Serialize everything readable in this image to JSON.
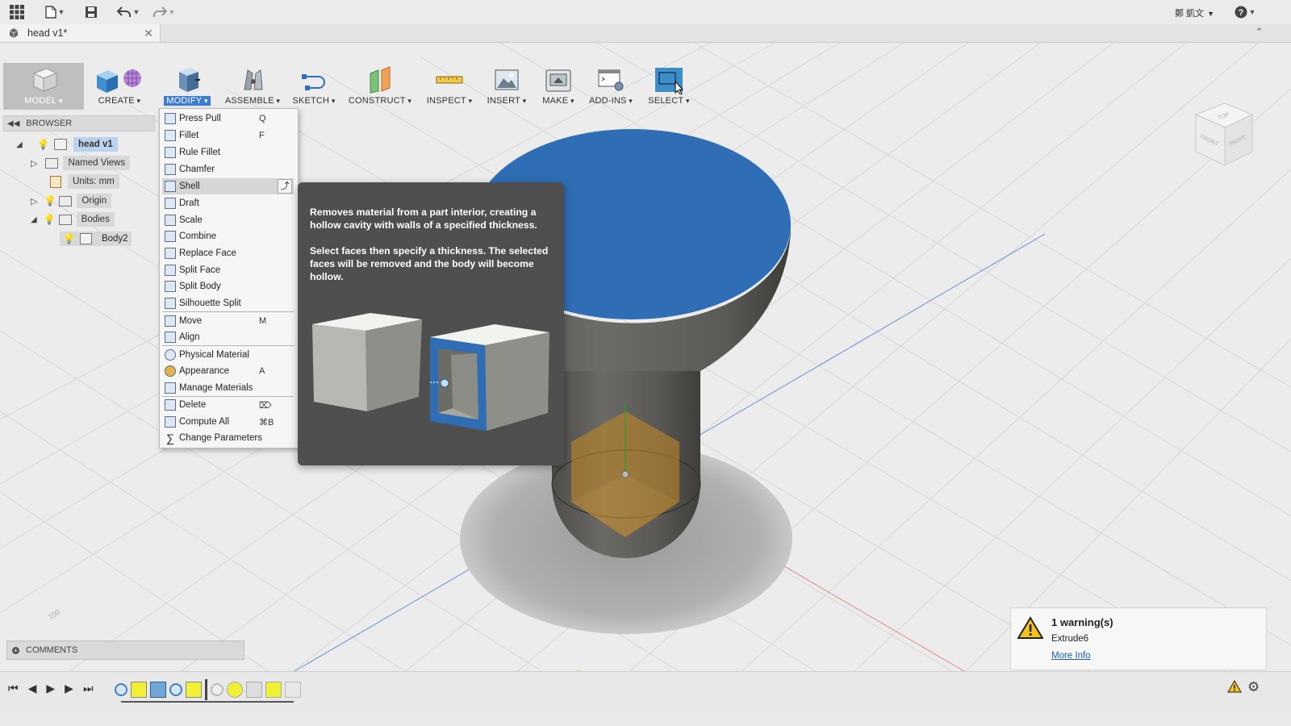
{
  "app": {
    "user_name": "鄭 凱文"
  },
  "document": {
    "tab_title": "head v1*"
  },
  "toolbar": {
    "workspace_label": "MODEL",
    "tools": [
      "CREATE",
      "MODIFY",
      "ASSEMBLE",
      "SKETCH",
      "CONSTRUCT",
      "INSPECT",
      "INSERT",
      "MAKE",
      "ADD-INS",
      "SELECT"
    ]
  },
  "browser": {
    "header": "BROWSER",
    "root": "head v1",
    "named_views": "Named Views",
    "units": "Units: mm",
    "origin": "Origin",
    "bodies": "Bodies",
    "body2": "Body2"
  },
  "modify_menu": {
    "items": [
      {
        "label": "Press Pull",
        "shortcut": "Q"
      },
      {
        "label": "Fillet",
        "shortcut": "F"
      },
      {
        "label": "Rule Fillet",
        "shortcut": ""
      },
      {
        "label": "Chamfer",
        "shortcut": ""
      },
      {
        "label": "Shell",
        "shortcut": ""
      },
      {
        "label": "Draft",
        "shortcut": ""
      },
      {
        "label": "Scale",
        "shortcut": ""
      },
      {
        "label": "Combine",
        "shortcut": ""
      },
      {
        "label": "Replace Face",
        "shortcut": ""
      },
      {
        "label": "Split Face",
        "shortcut": ""
      },
      {
        "label": "Split Body",
        "shortcut": ""
      },
      {
        "label": "Silhouette Split",
        "shortcut": ""
      },
      {
        "label": "Move",
        "shortcut": "M"
      },
      {
        "label": "Align",
        "shortcut": ""
      },
      {
        "label": "Physical Material",
        "shortcut": ""
      },
      {
        "label": "Appearance",
        "shortcut": "A"
      },
      {
        "label": "Manage Materials",
        "shortcut": ""
      },
      {
        "label": "Delete",
        "shortcut": "⌦"
      },
      {
        "label": "Compute All",
        "shortcut": "⌘B"
      },
      {
        "label": "Change Parameters",
        "shortcut": ""
      }
    ],
    "highlighted": "Shell"
  },
  "tooltip": {
    "line1": "Removes material from a part interior, creating a hollow cavity with walls of a specified thickness.",
    "line2": "Select faces then specify a thickness. The selected faces will be removed and the body will become hollow."
  },
  "viewcube": {
    "top": "TOP",
    "front": "FRONT",
    "right": "RIGHT"
  },
  "grid_label": "100",
  "comments": {
    "label": "COMMENTS"
  },
  "warning": {
    "title": "1 warning(s)",
    "item": "Extrude6",
    "link": "More Info"
  },
  "colors": {
    "selected_face": "#2f6db4",
    "body": "#5e5d58",
    "menu_highlight": "#3a7bd5"
  }
}
